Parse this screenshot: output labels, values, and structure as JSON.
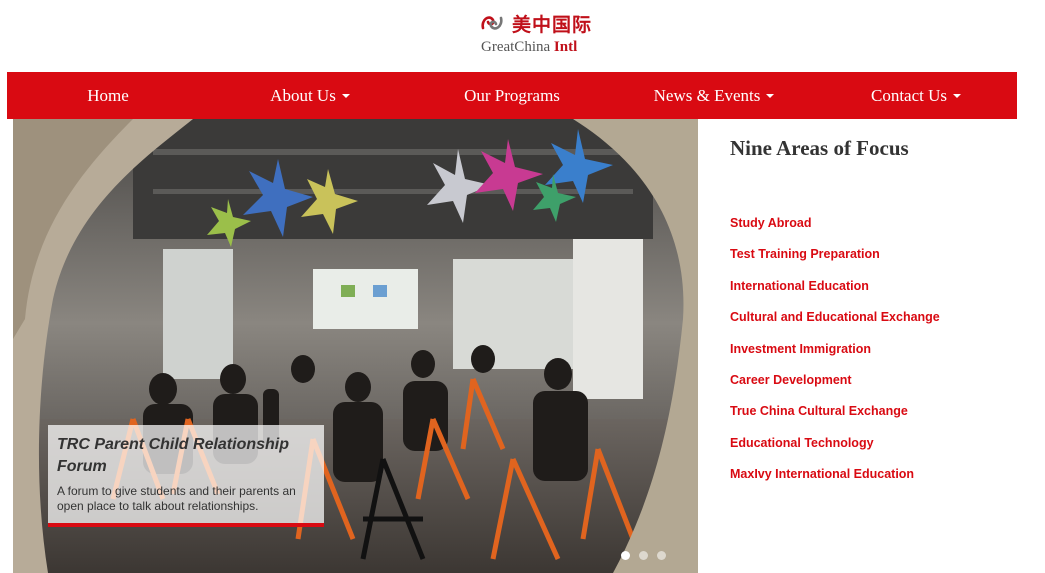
{
  "logo": {
    "name_cn": "美中国际",
    "name_en_a": "GreatChina",
    "name_en_b": "Intl"
  },
  "nav": {
    "home": "Home",
    "about": "About Us",
    "programs": "Our Programs",
    "news": "News & Events",
    "contact": "Contact Us"
  },
  "hero": {
    "caption_title": "TRC Parent Child Relationship Forum",
    "caption_text": "A forum to give students and their parents an open place to talk about relationships.",
    "slide_count": 3,
    "active_slide": 1
  },
  "focus": {
    "title": "Nine Areas of Focus",
    "items": [
      "Study Abroad",
      "Test Training Preparation",
      "International Education",
      "Cultural and Educational Exchange",
      "Investment Immigration",
      "Career Development",
      "True China Cultural Exchange",
      "Educational Technology",
      "MaxIvy International Education"
    ]
  },
  "colors": {
    "brand_red": "#d90a12",
    "text_dark": "#333333"
  }
}
